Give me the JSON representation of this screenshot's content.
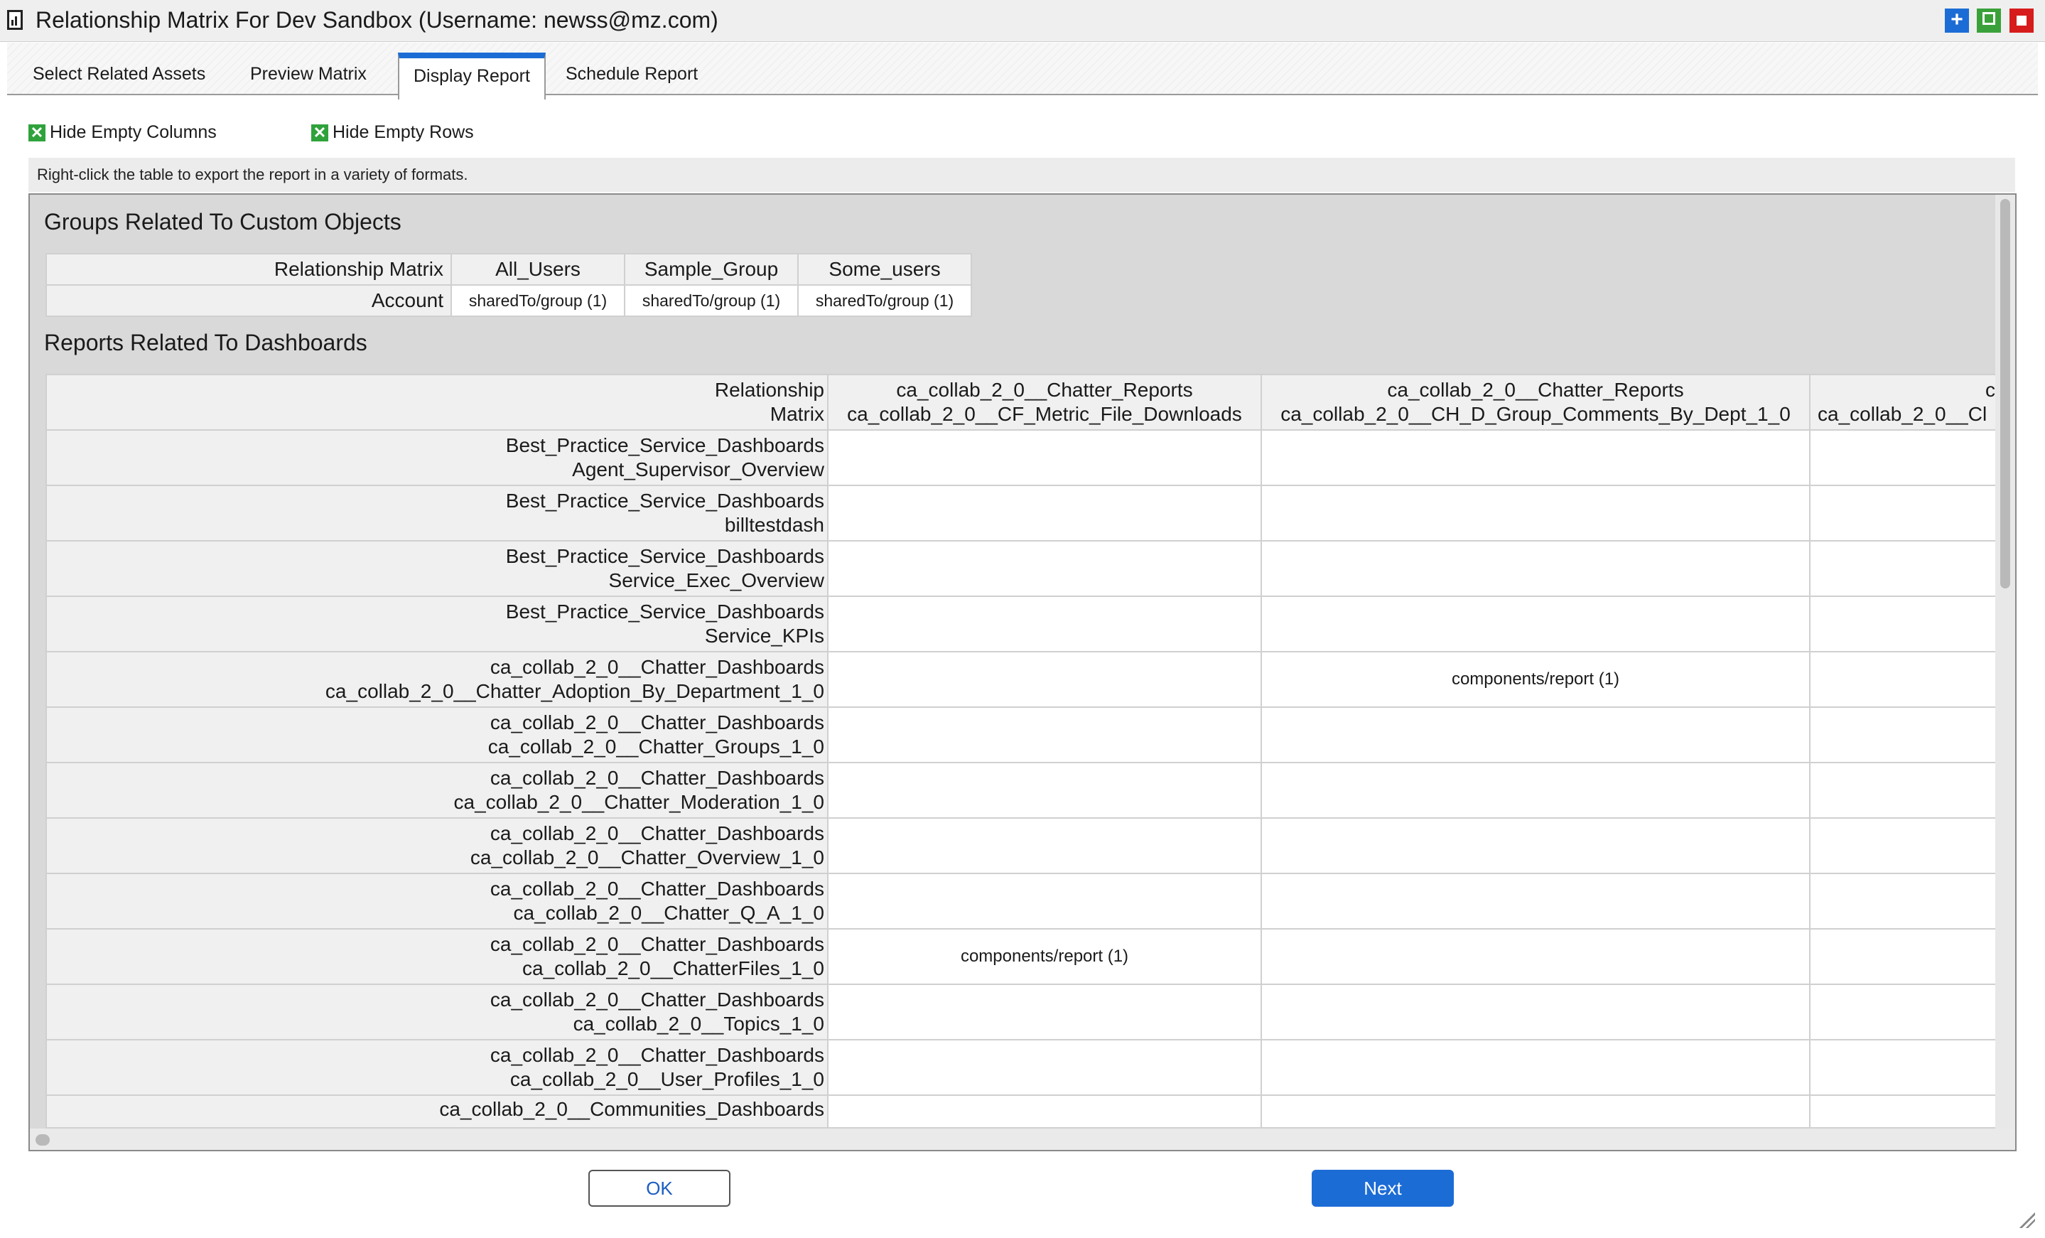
{
  "window": {
    "title": "Relationship Matrix For Dev Sandbox (Username: newss@mz.com)",
    "icon": "report-document-icon",
    "controls": {
      "plus": "+",
      "maximize_icon": "maximize-icon",
      "close_icon": "close-icon"
    }
  },
  "tabs": [
    {
      "label": "Select Related Assets",
      "active": false
    },
    {
      "label": "Preview Matrix",
      "active": false
    },
    {
      "label": "Display Report",
      "active": true
    },
    {
      "label": "Schedule Report",
      "active": false
    }
  ],
  "options": {
    "hide_empty_columns": {
      "label": "Hide Empty Columns",
      "checked": true
    },
    "hide_empty_rows": {
      "label": "Hide Empty Rows",
      "checked": true
    }
  },
  "info_text": "Right-click the table to export the report in a variety of formats.",
  "section1": {
    "title": "Groups Related To Custom Objects",
    "corner": "Relationship Matrix",
    "columns": [
      "All_Users",
      "Sample_Group",
      "Some_users"
    ],
    "rows": [
      {
        "label": "Account",
        "cells": [
          "sharedTo/group (1)",
          "sharedTo/group (1)",
          "sharedTo/group (1)"
        ]
      }
    ]
  },
  "section2": {
    "title": "Reports Related To Dashboards",
    "corner": [
      "Relationship",
      "Matrix"
    ],
    "columns": [
      [
        "ca_collab_2_0__Chatter_Reports",
        "ca_collab_2_0__CF_Metric_File_Downloads"
      ],
      [
        "ca_collab_2_0__Chatter_Reports",
        "ca_collab_2_0__CH_D_Group_Comments_By_Dept_1_0"
      ],
      [
        "c",
        "ca_collab_2_0__Cl"
      ]
    ],
    "rows": [
      {
        "label": [
          "Best_Practice_Service_Dashboards",
          "Agent_Supervisor_Overview"
        ],
        "cells": [
          "",
          "",
          ""
        ]
      },
      {
        "label": [
          "Best_Practice_Service_Dashboards",
          "billtestdash"
        ],
        "cells": [
          "",
          "",
          ""
        ]
      },
      {
        "label": [
          "Best_Practice_Service_Dashboards",
          "Service_Exec_Overview"
        ],
        "cells": [
          "",
          "",
          ""
        ]
      },
      {
        "label": [
          "Best_Practice_Service_Dashboards",
          "Service_KPIs"
        ],
        "cells": [
          "",
          "",
          ""
        ]
      },
      {
        "label": [
          "ca_collab_2_0__Chatter_Dashboards",
          "ca_collab_2_0__Chatter_Adoption_By_Department_1_0"
        ],
        "cells": [
          "",
          "components/report (1)",
          ""
        ]
      },
      {
        "label": [
          "ca_collab_2_0__Chatter_Dashboards",
          "ca_collab_2_0__Chatter_Groups_1_0"
        ],
        "cells": [
          "",
          "",
          ""
        ]
      },
      {
        "label": [
          "ca_collab_2_0__Chatter_Dashboards",
          "ca_collab_2_0__Chatter_Moderation_1_0"
        ],
        "cells": [
          "",
          "",
          ""
        ]
      },
      {
        "label": [
          "ca_collab_2_0__Chatter_Dashboards",
          "ca_collab_2_0__Chatter_Overview_1_0"
        ],
        "cells": [
          "",
          "",
          ""
        ]
      },
      {
        "label": [
          "ca_collab_2_0__Chatter_Dashboards",
          "ca_collab_2_0__Chatter_Q_A_1_0"
        ],
        "cells": [
          "",
          "",
          ""
        ]
      },
      {
        "label": [
          "ca_collab_2_0__Chatter_Dashboards",
          "ca_collab_2_0__ChatterFiles_1_0"
        ],
        "cells": [
          "components/report (1)",
          "",
          ""
        ]
      },
      {
        "label": [
          "ca_collab_2_0__Chatter_Dashboards",
          "ca_collab_2_0__Topics_1_0"
        ],
        "cells": [
          "",
          "",
          ""
        ]
      },
      {
        "label": [
          "ca_collab_2_0__Chatter_Dashboards",
          "ca_collab_2_0__User_Profiles_1_0"
        ],
        "cells": [
          "",
          "",
          ""
        ]
      },
      {
        "label": [
          "ca_collab_2_0__Communities_Dashboards",
          ""
        ],
        "cells": [
          "",
          "",
          ""
        ]
      }
    ]
  },
  "buttons": {
    "ok": "OK",
    "next": "Next"
  },
  "colors": {
    "accent": "#1c6cd6",
    "check": "#2fa23c",
    "close": "#d61c1c",
    "maximize": "#3aa13a"
  }
}
